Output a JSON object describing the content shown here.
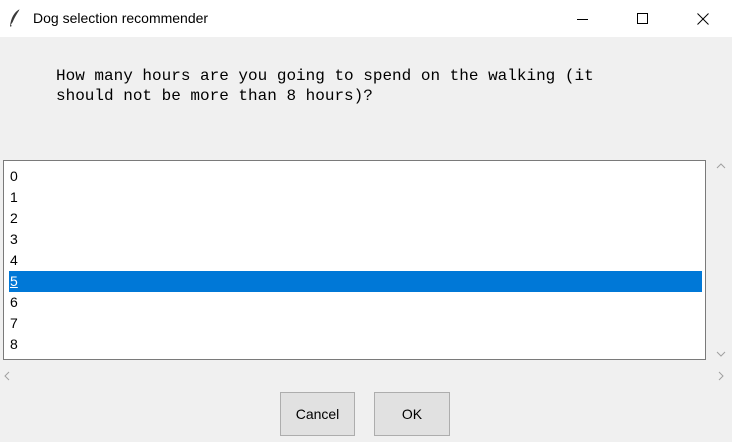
{
  "window": {
    "title": "Dog selection recommender",
    "icon": "feather-icon"
  },
  "prompt": {
    "line1": "How many hours are you going to spend on the walking (it",
    "line2": "should not be more than 8 hours)?"
  },
  "listbox": {
    "items": [
      "0",
      "1",
      "2",
      "3",
      "4",
      "5",
      "6",
      "7",
      "8"
    ],
    "selected": "5"
  },
  "buttons": {
    "cancel_label": "Cancel",
    "ok_label": "OK"
  },
  "colors": {
    "selection": "#0078d7",
    "background": "#f0f0f0",
    "titlebar": "#ffffff"
  }
}
